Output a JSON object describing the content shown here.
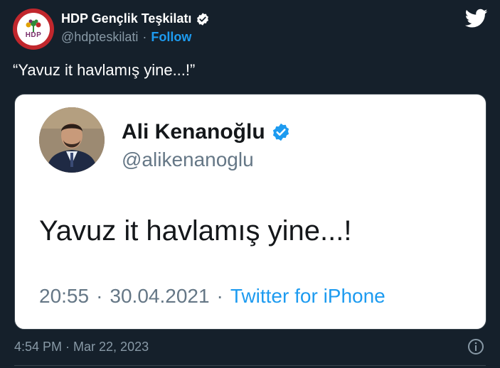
{
  "author": {
    "display_name": "HDP Gençlik Teşkilatı",
    "handle": "@hdpteskilati",
    "separator": "·",
    "follow_label": "Follow",
    "avatar_label": "HDP",
    "verified": true
  },
  "tweet": {
    "text": "“Yavuz it havlamış yine...!”"
  },
  "quoted_card": {
    "display_name": "Ali Kenanoğlu",
    "handle": "@alikenanoglu",
    "text": "Yavuz it havlamış yine...!",
    "time": "20:55",
    "dot1": "·",
    "date": "30.04.2021",
    "dot2": "·",
    "source": "Twitter for iPhone"
  },
  "footer": {
    "timestamp": "4:54 PM · Mar 22, 2023"
  },
  "icons": {
    "brand": "twitter-bird-icon",
    "verified": "verified-badge-icon",
    "info": "info-icon"
  },
  "colors": {
    "background": "#15202b",
    "accent": "#1d9bf0",
    "muted": "#8899a6",
    "avatar_ring": "#c1272d"
  }
}
